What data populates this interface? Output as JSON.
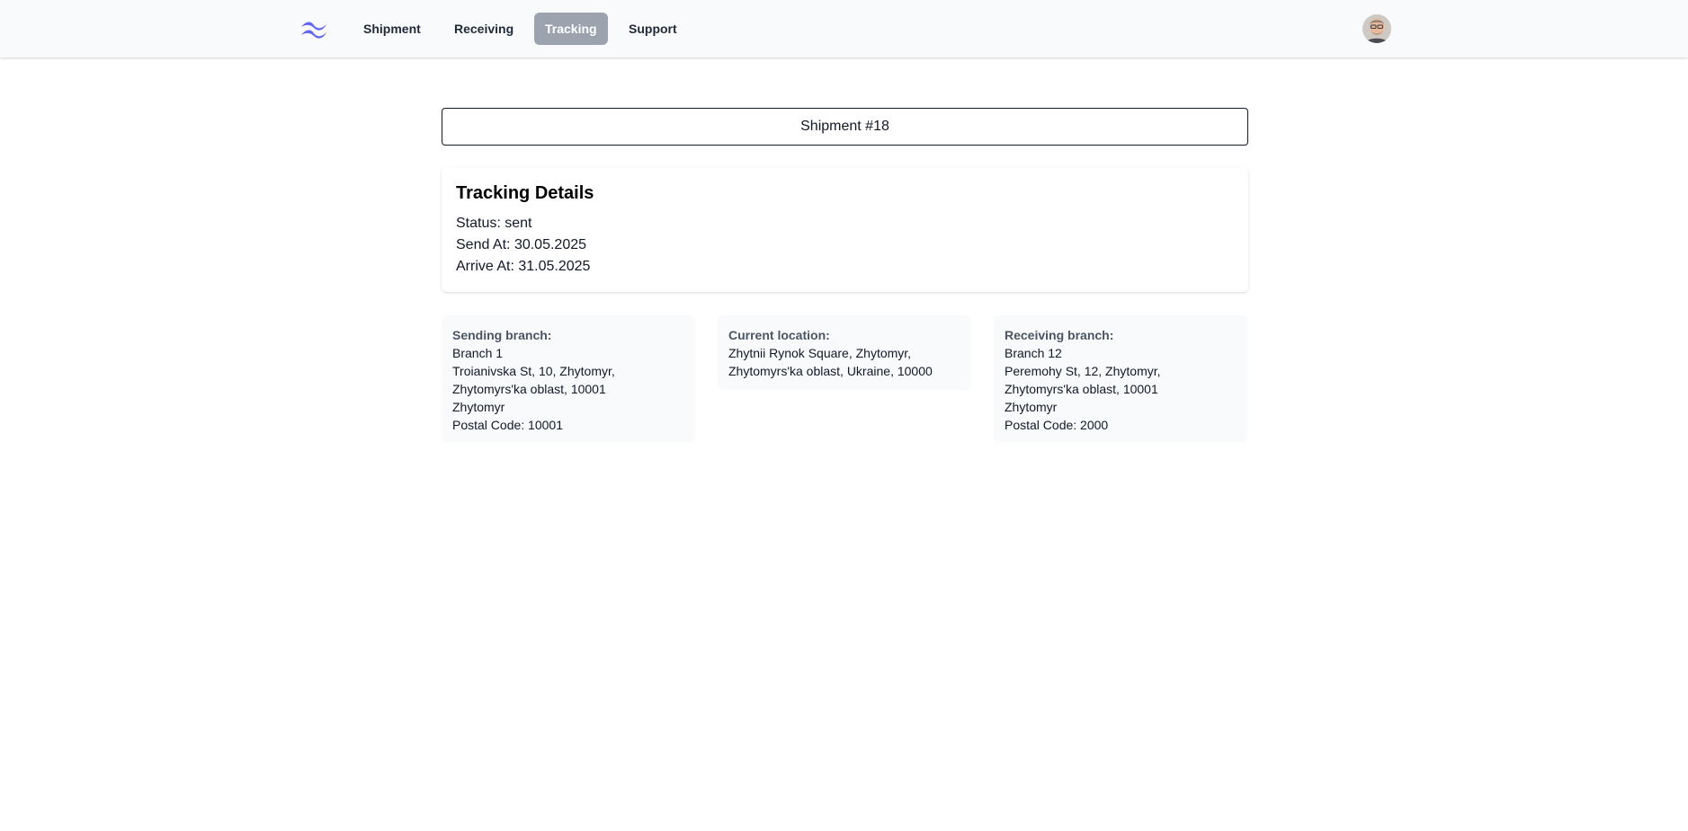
{
  "nav": {
    "items": [
      {
        "label": "Shipment"
      },
      {
        "label": "Receiving"
      },
      {
        "label": "Tracking"
      },
      {
        "label": "Support"
      }
    ],
    "active": "Tracking",
    "logo_icon": "tailwind-wave-logo",
    "avatar_icon": "user-avatar"
  },
  "search": {
    "value": "Shipment #18"
  },
  "tracking": {
    "title": "Tracking Details",
    "status": "Status: sent",
    "send_at": "Send At: 30.05.2025",
    "arrive_at": "Arrive At: 31.05.2025"
  },
  "sending_branch": {
    "label": "Sending branch:",
    "name": "Branch 1",
    "address": "Troianivska St, 10, Zhytomyr, Zhytomyrs'ka oblast, 10001",
    "city": "Zhytomyr",
    "postal": "Postal Code: 10001"
  },
  "current_location": {
    "label": "Current location:",
    "address": "Zhytnii Rynok Square, Zhytomyr, Zhytomyrs'ka oblast, Ukraine, 10000"
  },
  "receiving_branch": {
    "label": "Receiving branch:",
    "name": "Branch 12",
    "address": "Peremohy St, 12, Zhytomyr, Zhytomyrs'ka oblast, 10001",
    "city": "Zhytomyr",
    "postal": "Postal Code: 2000"
  },
  "colors": {
    "accent": "#6366f1",
    "nav_active_bg": "#9ca3af",
    "nav_bg": "#f9fafb",
    "card_bg": "#f9fafb"
  }
}
